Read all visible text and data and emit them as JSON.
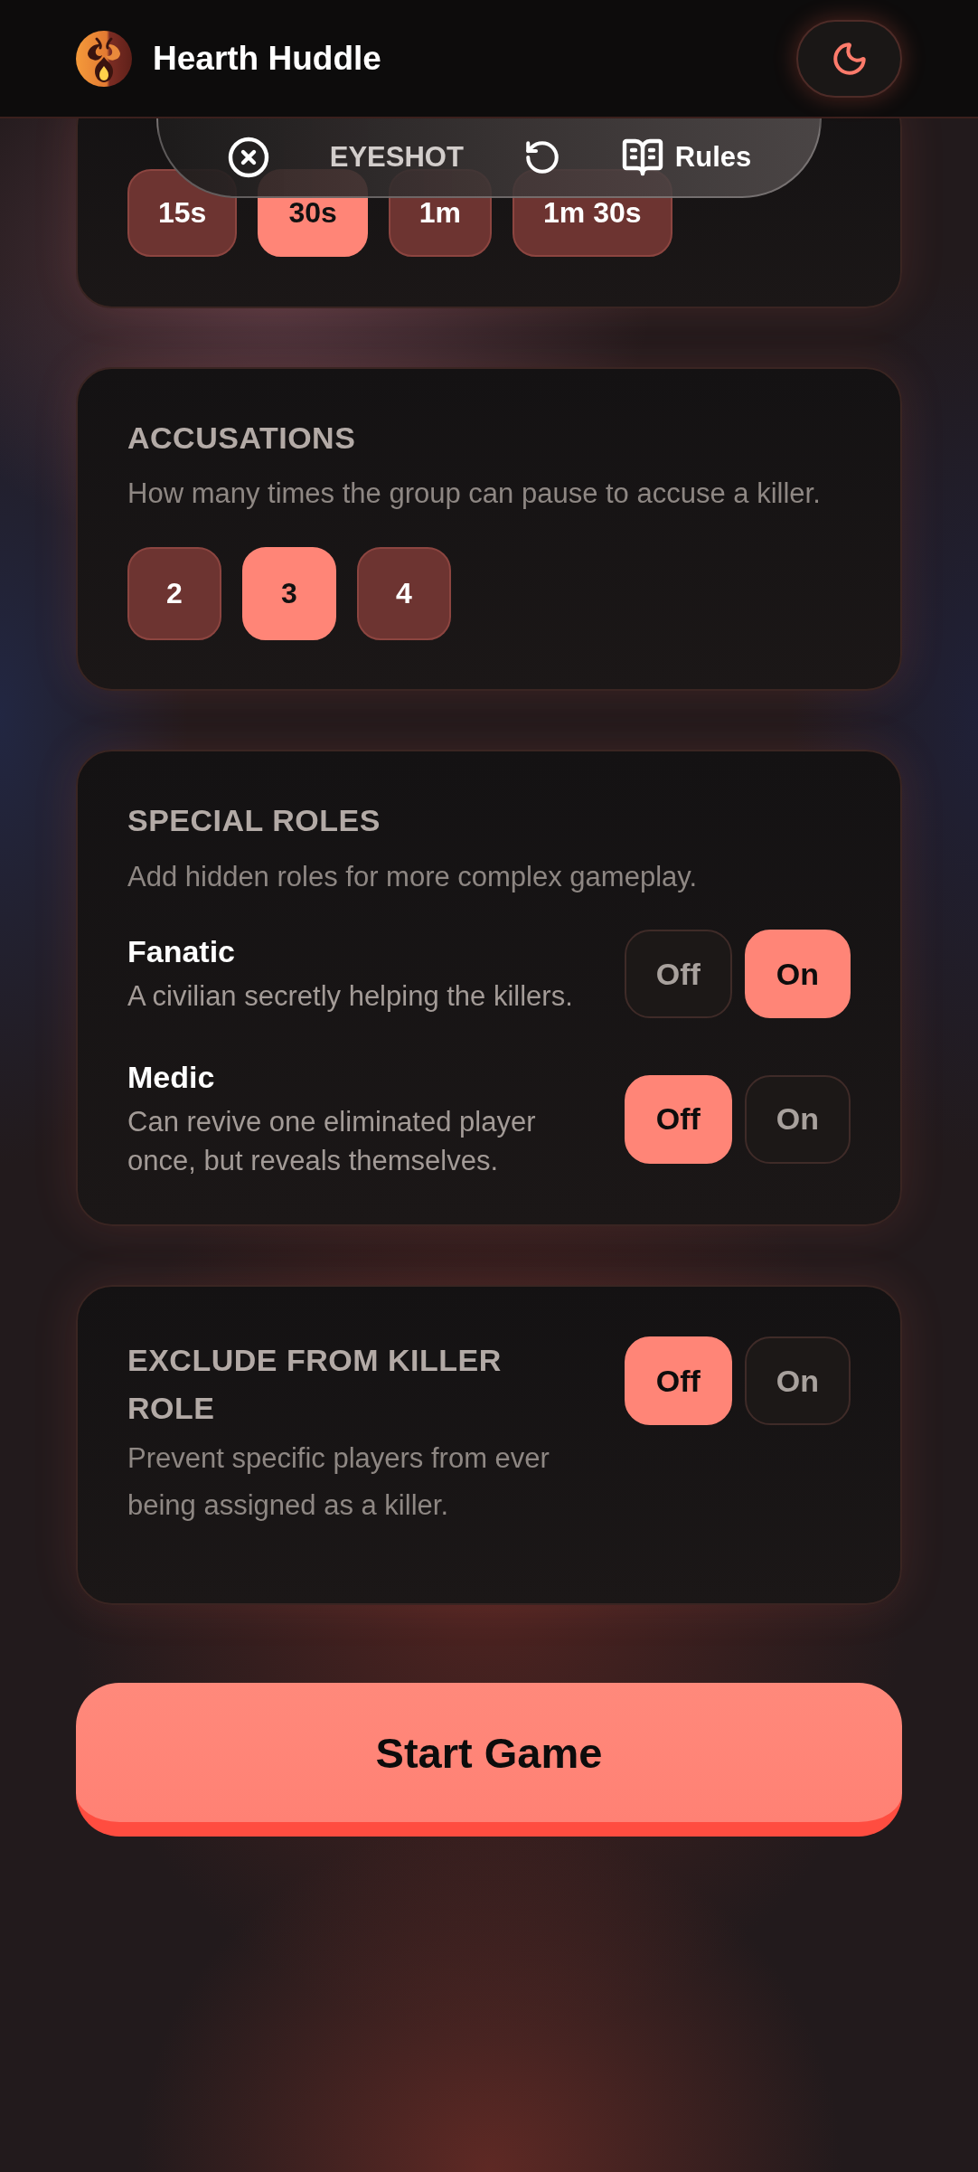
{
  "header": {
    "title": "Hearth Huddle"
  },
  "toolbar": {
    "brand": "EYESHOT",
    "rules_label": "Rules"
  },
  "card_1": {
    "options": [
      {
        "label": "15s",
        "selected": false
      },
      {
        "label": "30s",
        "selected": true
      },
      {
        "label": "1m",
        "selected": false
      },
      {
        "label": "1m 30s",
        "selected": false
      }
    ]
  },
  "accusations": {
    "title": "ACCUSATIONS",
    "description": "How many times the group can pause to accuse a killer.",
    "options": [
      {
        "label": "2",
        "selected": false
      },
      {
        "label": "3",
        "selected": true
      },
      {
        "label": "4",
        "selected": false
      }
    ]
  },
  "special_roles": {
    "title": "SPECIAL ROLES",
    "description": "Add hidden roles for more complex gameplay.",
    "roles": [
      {
        "name": "Fanatic",
        "description": "A civilian secretly helping the killers.",
        "toggle": [
          {
            "label": "Off",
            "selected": false
          },
          {
            "label": "On",
            "selected": true
          }
        ]
      },
      {
        "name": "Medic",
        "description": "Can revive one eliminated player once, but reveals themselves.",
        "toggle": [
          {
            "label": "Off",
            "selected": true
          },
          {
            "label": "On",
            "selected": false
          }
        ]
      }
    ]
  },
  "exclude_from_killer": {
    "title": "EXCLUDE FROM KILLER ROLE",
    "description": "Prevent specific players from ever being assigned as a killer.",
    "toggle": [
      {
        "label": "Off",
        "selected": true
      },
      {
        "label": "On",
        "selected": false
      }
    ]
  },
  "start_button": {
    "label": "Start Game"
  }
}
